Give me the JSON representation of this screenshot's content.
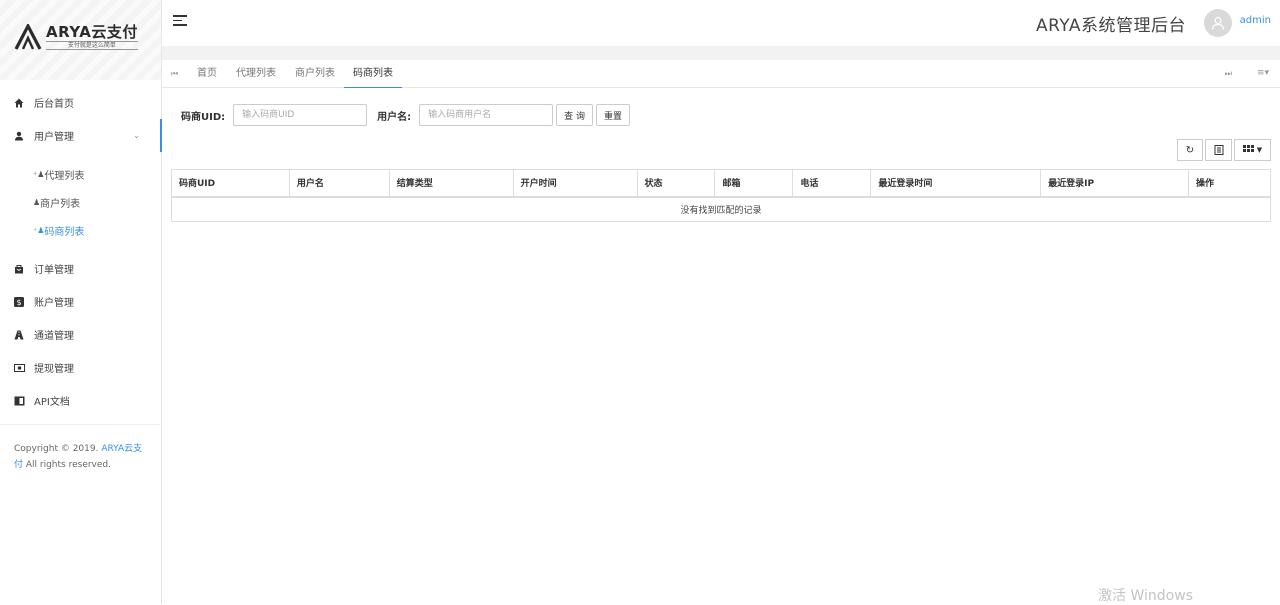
{
  "brand": {
    "name": "ARYA云支付",
    "slogan": "支付就是这么简单"
  },
  "header": {
    "title": "ARYA系统管理后台",
    "user": "admin"
  },
  "sidebar": {
    "items": [
      {
        "label": "后台首页",
        "icon": "home-icon"
      },
      {
        "label": "用户管理",
        "icon": "user-icon"
      },
      {
        "label": "订单管理",
        "icon": "bag-icon"
      },
      {
        "label": "账户管理",
        "icon": "dollar-icon"
      },
      {
        "label": "通道管理",
        "icon": "road-icon"
      },
      {
        "label": "提现管理",
        "icon": "money-icon"
      },
      {
        "label": "API文档",
        "icon": "doc-icon"
      }
    ],
    "sub_items": [
      {
        "label": "代理列表"
      },
      {
        "label": "商户列表"
      },
      {
        "label": "码商列表"
      }
    ]
  },
  "copyright": {
    "prefix": "Copyright © 2019. ",
    "brand": "ARYA云支付",
    "suffix": " All rights reserved."
  },
  "tabs": [
    "首页",
    "代理列表",
    "商户列表",
    "码商列表"
  ],
  "search": {
    "uid_label": "码商UID:",
    "uid_placeholder": "输入码商UID",
    "name_label": "用户名:",
    "name_placeholder": "输入码商用户名",
    "query_label": "查 询",
    "reset_label": "重置"
  },
  "table": {
    "columns": [
      "码商UID",
      "用户名",
      "结算类型",
      "开户时间",
      "状态",
      "邮箱",
      "电话",
      "最近登录时间",
      "最近登录IP",
      "操作"
    ],
    "empty_text": "没有找到匹配的记录"
  },
  "watermark": "激活 Windows",
  "colors": {
    "accent": "#3a8ee6"
  }
}
